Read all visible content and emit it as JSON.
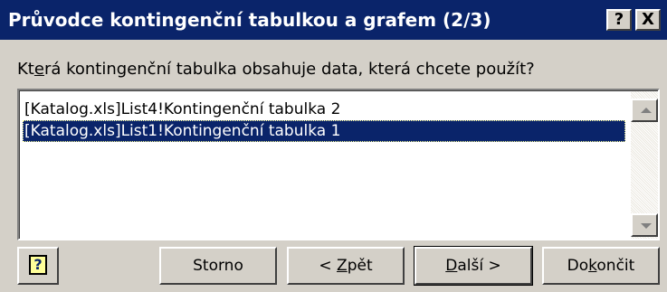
{
  "window": {
    "title": "Průvodce kontingenční tabulkou a grafem (2/3)",
    "help_button": "?",
    "close_button": "X"
  },
  "prompt": {
    "before": "Kt",
    "underlined": "e",
    "after": "rá kontingenční tabulka obsahuje data, která chcete použít?"
  },
  "list": {
    "items": [
      {
        "label": "[Katalog.xls]List4!Kontingenční tabulka 2",
        "selected": false
      },
      {
        "label": "[Katalog.xls]List1!Kontingenční tabulka 1",
        "selected": true
      }
    ]
  },
  "buttons": {
    "help_icon": "question-mark-icon",
    "help_glyph": "?",
    "storno": "Storno",
    "back": {
      "before": "< ",
      "underlined": "Z",
      "after": "pět"
    },
    "next": {
      "before": "",
      "underlined": "D",
      "after": "alší >"
    },
    "finish": {
      "before": "Do",
      "underlined": "k",
      "after": "ončit"
    }
  },
  "colors": {
    "titlebar": "#0a246a",
    "face": "#d4d0c8",
    "selection": "#0a246a"
  }
}
